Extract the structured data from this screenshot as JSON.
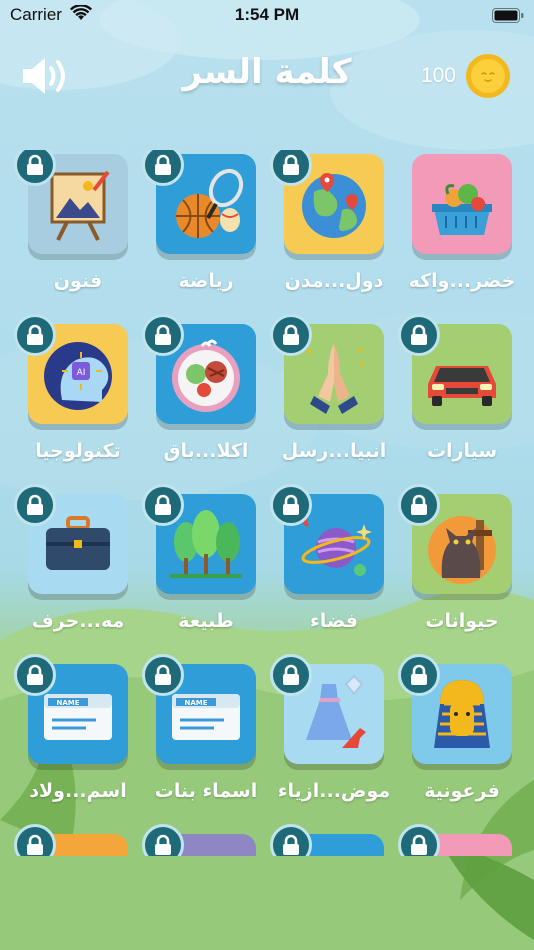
{
  "status": {
    "carrier": "Carrier",
    "time": "1:54 PM"
  },
  "header": {
    "title": "كلمة السر",
    "coins": "100"
  },
  "categories": [
    {
      "label": "خضر...واكه",
      "color": "#f39ab8",
      "icon": "basket-icon",
      "locked": false
    },
    {
      "label": "دول...مدن",
      "color": "#f7cb53",
      "icon": "globe-icon",
      "locked": true
    },
    {
      "label": "رياضة",
      "color": "#2f9ed8",
      "icon": "sports-balls-icon",
      "locked": true
    },
    {
      "label": "فنون",
      "color": "#a9cde0",
      "icon": "easel-icon",
      "locked": true
    },
    {
      "label": "سيارات",
      "color": "#a3cf72",
      "icon": "car-icon",
      "locked": true
    },
    {
      "label": "انبيا...رسل",
      "color": "#a3cf72",
      "icon": "praying-hands-icon",
      "locked": true
    },
    {
      "label": "اكلا...باق",
      "color": "#2f9ed8",
      "icon": "food-plate-icon",
      "locked": true
    },
    {
      "label": "تكنولوجيا",
      "color": "#f7cb53",
      "icon": "ai-head-icon",
      "locked": true
    },
    {
      "label": "حيوانات",
      "color": "#a3cf72",
      "icon": "cat-icon",
      "locked": true
    },
    {
      "label": "فضاء",
      "color": "#2f9ed8",
      "icon": "planet-icon",
      "locked": true
    },
    {
      "label": "طبيعة",
      "color": "#2f9ed8",
      "icon": "trees-icon",
      "locked": true
    },
    {
      "label": "مه...حرف",
      "color": "#a8dbf2",
      "icon": "briefcase-icon",
      "locked": true
    },
    {
      "label": "فرعونية",
      "color": "#7fc9ea",
      "icon": "pharaoh-icon",
      "locked": true
    },
    {
      "label": "موض...ازياء",
      "color": "#a8dbf2",
      "icon": "dress-icon",
      "locked": true
    },
    {
      "label": "اسماء بنات",
      "color": "#2f9ed8",
      "icon": "name-tag-icon",
      "locked": true
    },
    {
      "label": "اسم...ولاد",
      "color": "#2f9ed8",
      "icon": "name-tag-icon",
      "locked": true
    },
    {
      "label": "",
      "color": "#f39ab8",
      "icon": "partial-icon",
      "locked": true
    },
    {
      "label": "",
      "color": "#2f9ed8",
      "icon": "partial-icon",
      "locked": true
    },
    {
      "label": "",
      "color": "#8f86c4",
      "icon": "partial-icon",
      "locked": true
    },
    {
      "label": "",
      "color": "#f5a63a",
      "icon": "partial-icon",
      "locked": true
    }
  ]
}
